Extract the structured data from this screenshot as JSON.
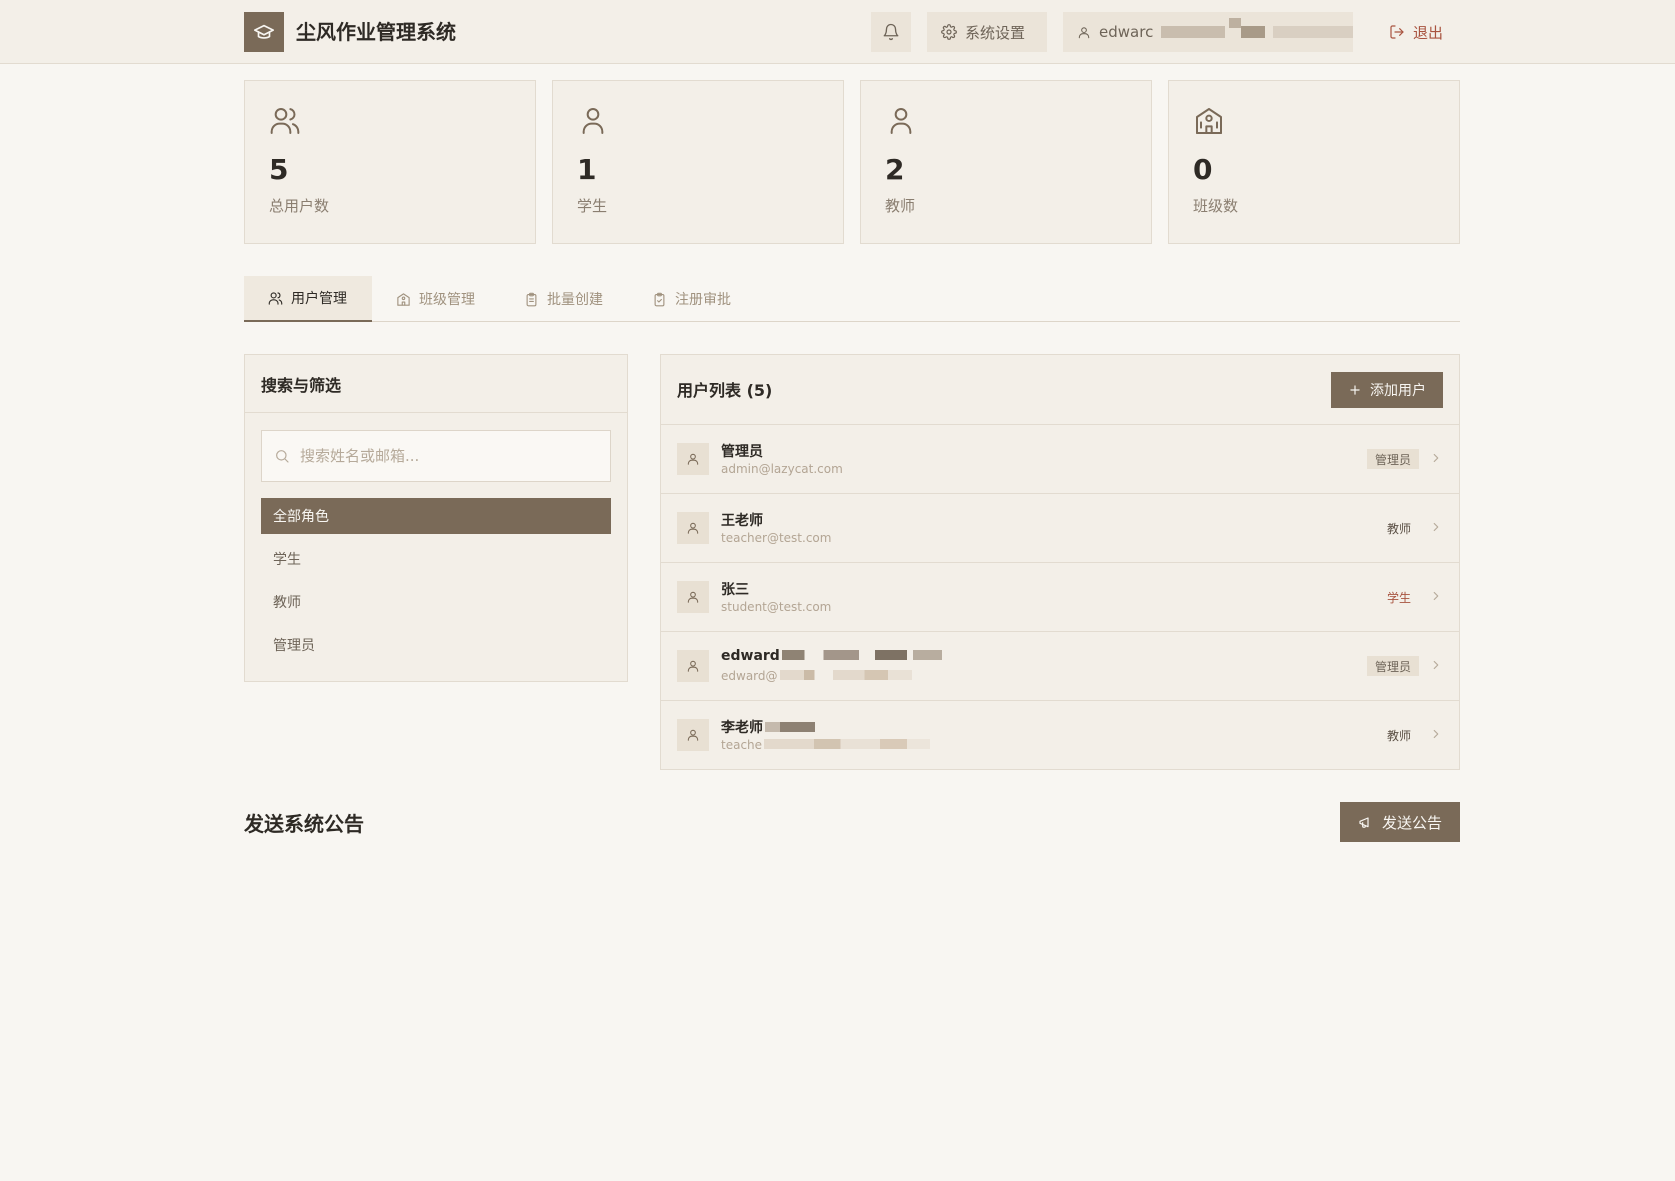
{
  "header": {
    "app_title": "尘风作业管理系统",
    "settings_label": "系统设置",
    "user_label": "edwarc",
    "logout_label": "退出"
  },
  "stats": [
    {
      "value": "5",
      "label": "总用户数",
      "icon": "users-icon"
    },
    {
      "value": "1",
      "label": "学生",
      "icon": "user-icon"
    },
    {
      "value": "2",
      "label": "教师",
      "icon": "user-icon"
    },
    {
      "value": "0",
      "label": "班级数",
      "icon": "school-icon"
    }
  ],
  "tabs": [
    {
      "label": "用户管理",
      "icon": "users-icon",
      "active": true
    },
    {
      "label": "班级管理",
      "icon": "school-icon",
      "active": false
    },
    {
      "label": "批量创建",
      "icon": "clipboard-icon",
      "active": false
    },
    {
      "label": "注册审批",
      "icon": "clipboard-check-icon",
      "active": false
    }
  ],
  "filter": {
    "title": "搜索与筛选",
    "search_placeholder": "搜索姓名或邮箱...",
    "roles": [
      "全部角色",
      "学生",
      "教师",
      "管理员"
    ],
    "active_role": "全部角色"
  },
  "user_list": {
    "title": "用户列表 (5)",
    "add_label": "添加用户",
    "users": [
      {
        "name": "管理员",
        "email": "admin@lazycat.com",
        "role": "管理员",
        "role_type": "admin"
      },
      {
        "name": "王老师",
        "email": "teacher@test.com",
        "role": "教师",
        "role_type": "teacher"
      },
      {
        "name": "张三",
        "email": "student@test.com",
        "role": "学生",
        "role_type": "student"
      },
      {
        "name": "edward",
        "email": "edward@",
        "role": "管理员",
        "role_type": "admin"
      },
      {
        "name": "李老师",
        "email": "teache",
        "role": "教师",
        "role_type": "teacher"
      }
    ]
  },
  "announcement": {
    "title": "发送系统公告",
    "send_label": "发送公告"
  },
  "colors": {
    "accent": "#7a6a58",
    "background": "#f8f6f2",
    "panel": "#f3efe8",
    "danger": "#a8533f"
  }
}
